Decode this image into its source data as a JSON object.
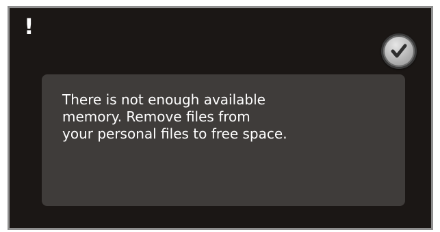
{
  "dialog": {
    "alert_symbol": "!",
    "message": "There is not enough available\nmemory. Remove files from\nyour personal files to free space.",
    "confirm_icon": "check-icon",
    "colors": {
      "background": "#1b1715",
      "panel": "#3f3c3a",
      "border": "#8f8f8f",
      "text": "#ffffff"
    }
  }
}
